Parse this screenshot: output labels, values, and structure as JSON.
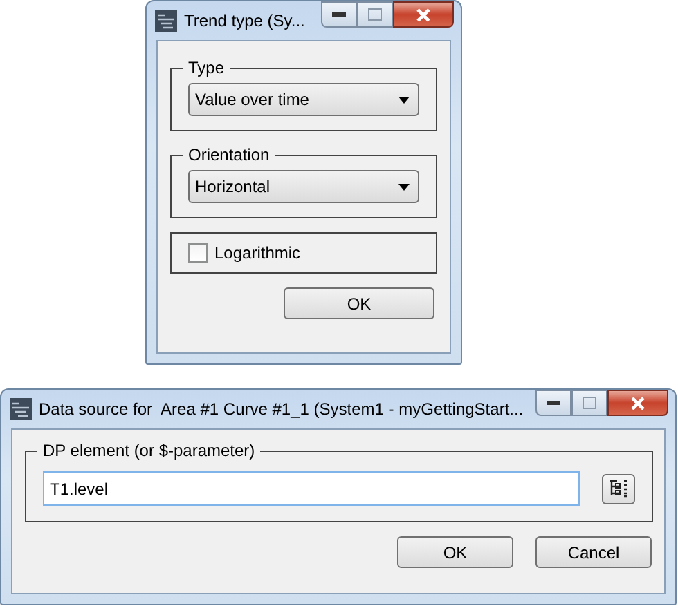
{
  "trend_window": {
    "title": "Trend type (Sy...",
    "groups": [
      {
        "kind": "dropdown",
        "label": "Type",
        "value": "Value over time"
      },
      {
        "kind": "dropdown",
        "label": "Orientation",
        "value": "Horizontal"
      },
      {
        "kind": "checkbox",
        "label": "Logarithmic",
        "checked": false
      }
    ],
    "buttons": [
      "OK"
    ]
  },
  "source_window": {
    "title": "Data source for  Area #1 Curve #1_1 (System1 - myGettingStart...",
    "group_label": "DP element (or $-parameter)",
    "field": {
      "value": "T1.level"
    },
    "buttons": [
      "OK",
      "Cancel"
    ]
  }
}
